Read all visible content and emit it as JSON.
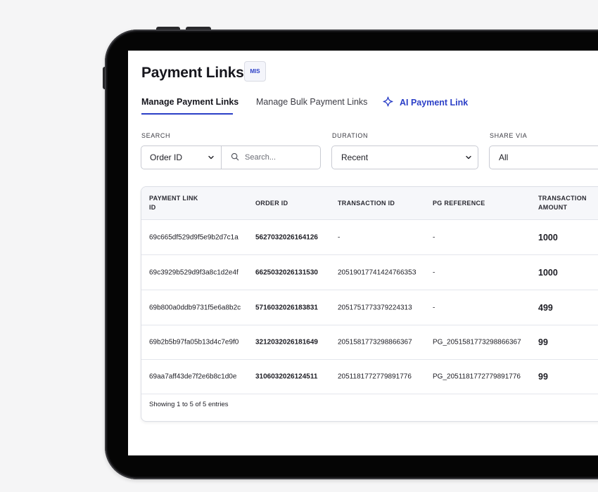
{
  "header": {
    "title": "Payment Links",
    "badge": "MIS"
  },
  "tabs": [
    {
      "label": "Manage Payment Links",
      "active": true
    },
    {
      "label": "Manage Bulk Payment Links",
      "active": false
    },
    {
      "label": "AI Payment Link",
      "active": false,
      "icon": "sparkle-icon"
    }
  ],
  "filters": {
    "search": {
      "label": "SEARCH",
      "field_value": "Order ID",
      "placeholder": "Search..."
    },
    "duration": {
      "label": "DURATION",
      "value": "Recent"
    },
    "share_via": {
      "label": "SHARE VIA",
      "value": "All"
    }
  },
  "table": {
    "columns": [
      "PAYMENT LINK ID",
      "ORDER ID",
      "TRANSACTION ID",
      "PG REFERENCE",
      "TRANSACTION AMOUNT"
    ],
    "rows": [
      [
        "69c665df529d9f5e9b2d7c1a",
        "5627032026164126",
        "-",
        "-",
        "1000"
      ],
      [
        "69c3929b529d9f3a8c1d2e4f",
        "6625032026131530",
        "2051901774142476635З",
        "-",
        "1000"
      ],
      [
        "69b800a0ddb9731f5e6a8b2c",
        "5716032026183831",
        "2051751773379224313",
        "-",
        "499"
      ],
      [
        "69b2b5b97fa05b13d4c7e9f0",
        "3212032026181649",
        "2051581773298866367",
        "PG_2051581773298866367",
        "99"
      ],
      [
        "69aa7aff43de7f2e6b8c1d0e",
        "3106032026124511",
        "2051181772779891776",
        "PG_2051181772779891776",
        "99"
      ]
    ],
    "footer": "Showing 1 to 5 of 5 entries"
  },
  "colors": {
    "accent": "#2b3fc7",
    "device": "#111113",
    "background": "#f5f5f6"
  }
}
